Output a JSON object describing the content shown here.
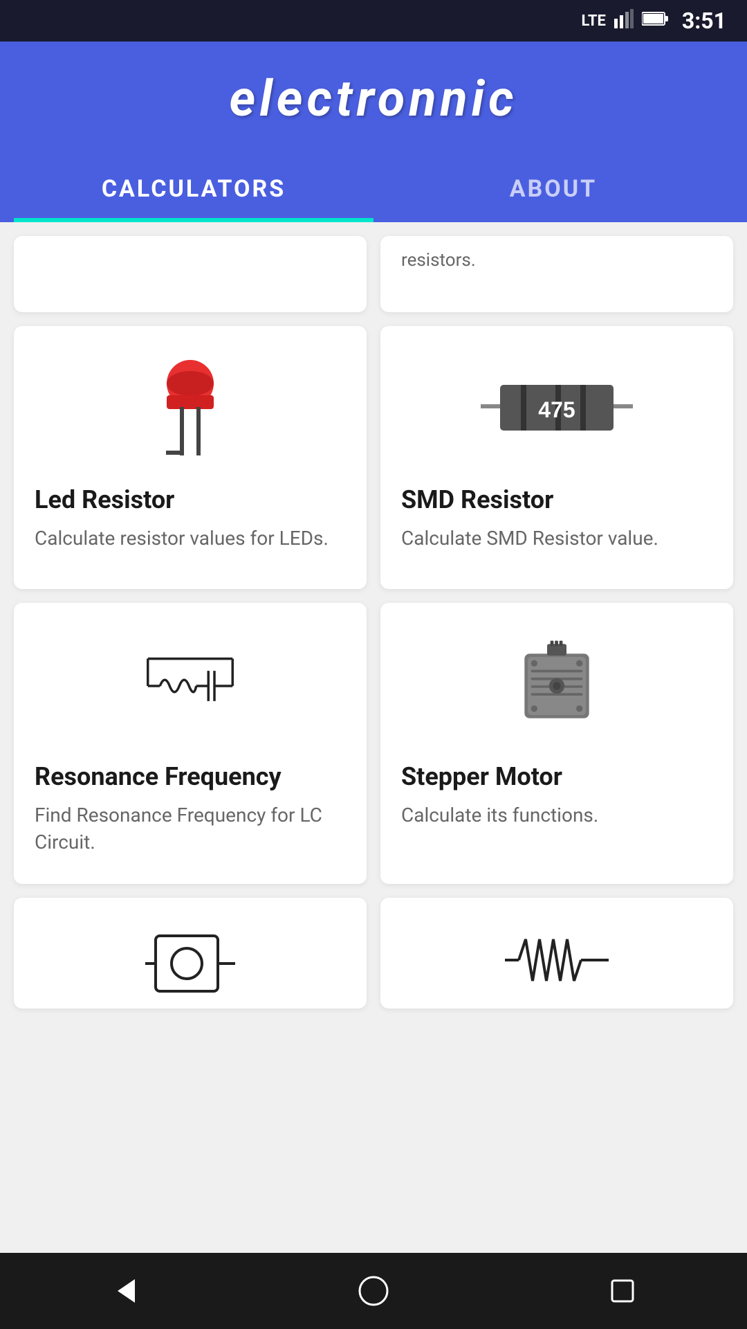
{
  "status_bar": {
    "time": "3:51",
    "icons": [
      "lte",
      "signal",
      "battery"
    ]
  },
  "header": {
    "title": "electronnic",
    "tabs": [
      {
        "label": "CALCULATORS",
        "active": true
      },
      {
        "label": "ABOUT",
        "active": false
      }
    ]
  },
  "cards": [
    {
      "id": "partial-left",
      "partial_text": "",
      "visible": false
    },
    {
      "id": "partial-right",
      "partial_text": "resistors.",
      "visible": true
    },
    {
      "id": "led-resistor",
      "title": "Led Resistor",
      "description": "Calculate resistor values for LEDs.",
      "icon": "led-icon"
    },
    {
      "id": "smd-resistor",
      "title": "SMD Resistor",
      "description": "Calculate SMD Resistor value.",
      "icon": "smd-icon",
      "smd_value": "475"
    },
    {
      "id": "resonance-frequency",
      "title": "Resonance Frequency",
      "description": "Find Resonance Frequency for LC Circuit.",
      "icon": "resonance-icon"
    },
    {
      "id": "stepper-motor",
      "title": "Stepper Motor",
      "description": "Calculate its functions.",
      "icon": "stepper-icon"
    },
    {
      "id": "bottom-left",
      "title": "",
      "description": "",
      "icon": "capacitor-icon"
    },
    {
      "id": "bottom-right",
      "title": "",
      "description": "",
      "icon": "resistor-icon"
    }
  ],
  "nav": {
    "back_label": "back",
    "home_label": "home",
    "recent_label": "recent"
  },
  "colors": {
    "primary": "#4a5fe0",
    "accent": "#00e5cc",
    "background": "#f0f0f0",
    "card": "#ffffff",
    "text_primary": "#1a1a1a",
    "text_secondary": "#666666"
  }
}
